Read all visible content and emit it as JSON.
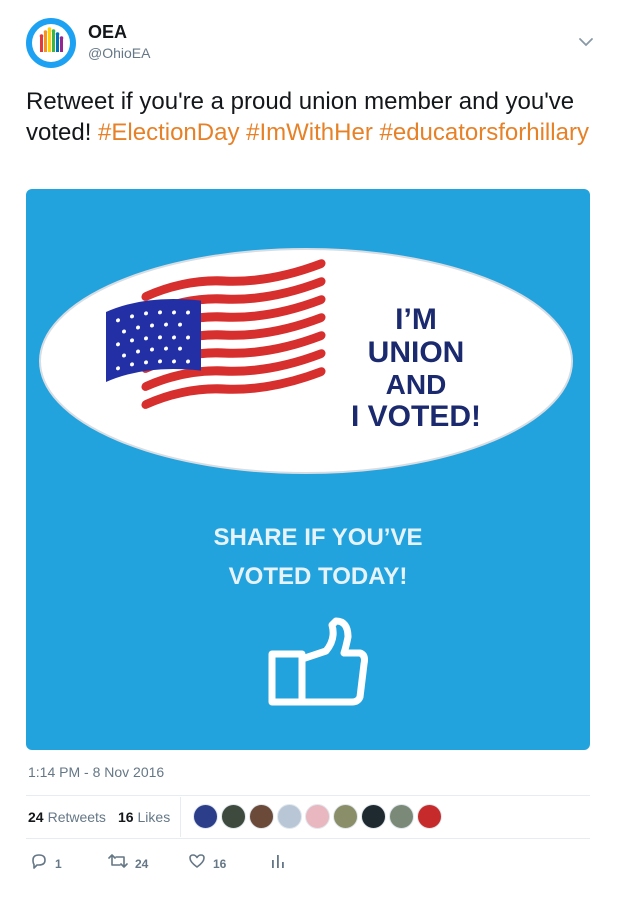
{
  "tweet": {
    "display_name": "OEA",
    "handle": "@OhioEA",
    "text_plain": "Retweet if you're a proud union member and you've voted! ",
    "hashtags": [
      "#ElectionDay",
      "#ImWithHer",
      "#educatorsforhillary"
    ],
    "timestamp": "1:14 PM - 8 Nov 2016"
  },
  "media": {
    "sticker_lines": [
      "I’M",
      "UNION",
      "AND",
      "I VOTED!"
    ],
    "share_lines": [
      "SHARE IF YOU’VE",
      "VOTED TODAY!"
    ]
  },
  "stats": {
    "retweets_count": "24",
    "retweets_label": "Retweets",
    "likes_count": "16",
    "likes_label": "Likes"
  },
  "actions": {
    "reply_count": "1",
    "retweet_count": "24",
    "like_count": "16"
  },
  "colors": {
    "hashtag": "#e78128",
    "media_bg": "#22a3dd",
    "sticker_text": "#1b2a6f"
  },
  "icons": [
    "chevron-down-icon",
    "reply-icon",
    "retweet-icon",
    "like-icon",
    "analytics-icon",
    "thumbs-up-icon",
    "flag-icon"
  ]
}
